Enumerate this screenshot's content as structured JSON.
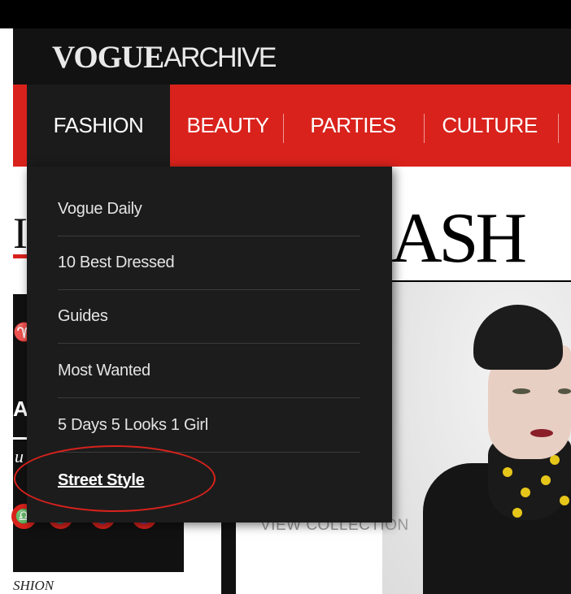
{
  "brand": {
    "logo_bold": "VOGUE",
    "logo_light": "ARCHIVE"
  },
  "nav": {
    "items": [
      {
        "label": "FASHION",
        "active": true
      },
      {
        "label": "BEAUTY"
      },
      {
        "label": "PARTIES"
      },
      {
        "label": "CULTURE"
      }
    ]
  },
  "dropdown": {
    "items": [
      {
        "label": "Vogue Daily"
      },
      {
        "label": "10 Best Dressed"
      },
      {
        "label": "Guides"
      },
      {
        "label": "Most Wanted"
      },
      {
        "label": "5 Days 5 Looks 1 Girl"
      },
      {
        "label": "Street Style",
        "selected": true
      }
    ]
  },
  "background": {
    "headline_fragment": "ASH",
    "view_collection": "VIEW COLLECTION",
    "left_initial": "I",
    "left_bottom_text": "SHION",
    "left_fragments": [
      "♈",
      "Al",
      "u"
    ],
    "zodiac": [
      "♎",
      "♏",
      "♐",
      "♑"
    ]
  },
  "colors": {
    "accent": "#d9221c",
    "dark": "#1c1c1c",
    "annotation": "#d9221c"
  }
}
